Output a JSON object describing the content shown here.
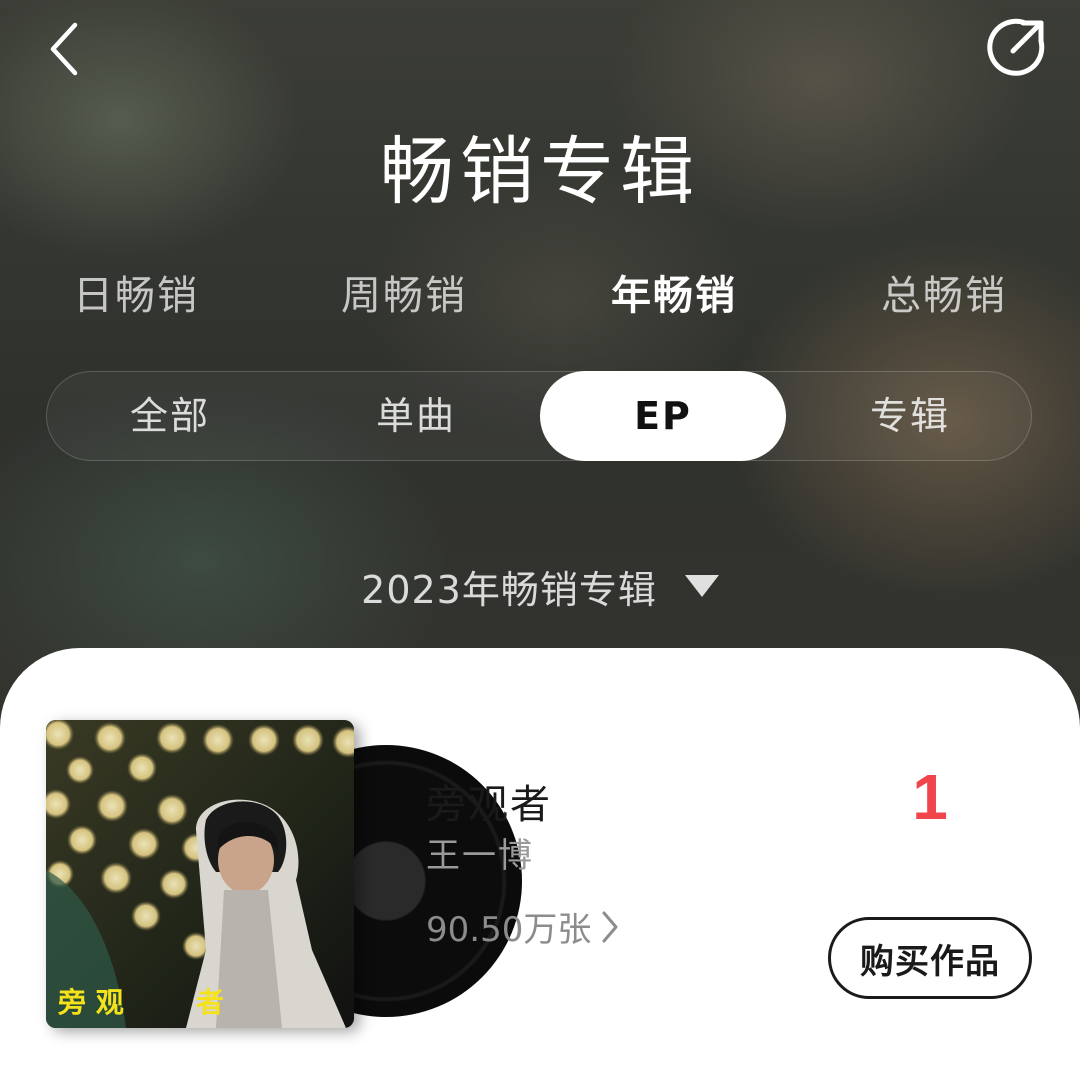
{
  "header": {
    "title": "畅销专辑",
    "back_icon": "chevron-left-icon",
    "share_icon": "share-icon"
  },
  "period_tabs": [
    {
      "label": "日畅销",
      "active": false
    },
    {
      "label": "周畅销",
      "active": false
    },
    {
      "label": "年畅销",
      "active": true
    },
    {
      "label": "总畅销",
      "active": false
    }
  ],
  "type_tabs": [
    {
      "label": "全部",
      "active": false
    },
    {
      "label": "单曲",
      "active": false
    },
    {
      "label": "EP",
      "active": true
    },
    {
      "label": "专辑",
      "active": false
    }
  ],
  "year_selector": {
    "label": "2023年畅销专辑",
    "caret_icon": "caret-down-icon"
  },
  "items": [
    {
      "rank": "1",
      "title": "旁观者",
      "artist": "王一博",
      "sales": "90.50万张",
      "buy_label": "购买作品",
      "cover_text": [
        "旁 观",
        "者"
      ]
    }
  ],
  "colors": {
    "rank": "#f0454b",
    "active_segment_bg": "#ffffff",
    "cover_text": "#f5e21a"
  }
}
